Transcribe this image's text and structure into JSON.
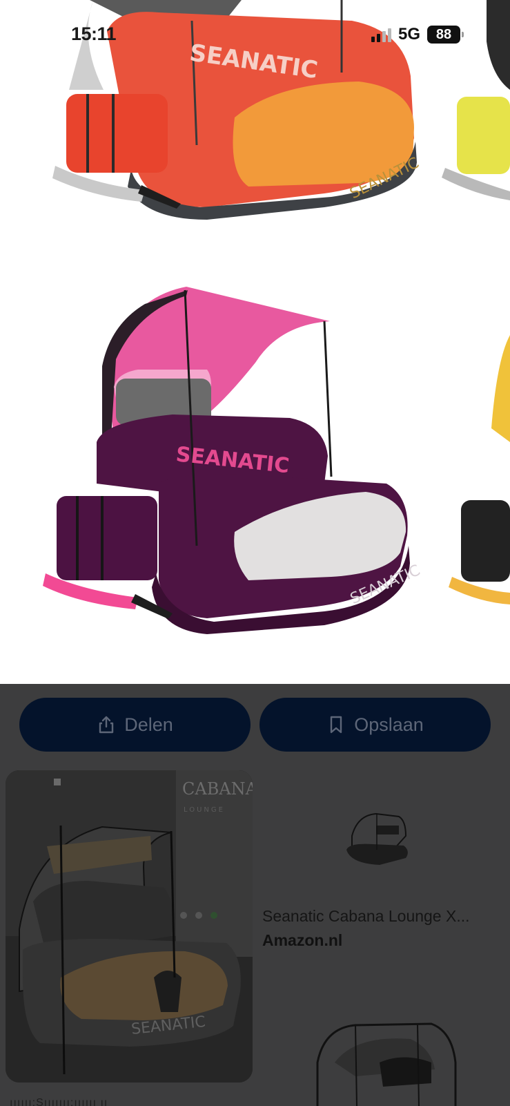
{
  "status_bar": {
    "time": "15:11",
    "network": "5G",
    "battery": "88"
  },
  "hero": {
    "logo_text": "SEANATIC",
    "colors": {
      "top_lounger_red": "#e9533c",
      "top_lounger_orange": "#f29a3a",
      "bottom_canopy_pink": "#e8599f",
      "bottom_cushion_purple": "#4e1443"
    }
  },
  "actions": {
    "share_label": "Delen",
    "save_label": "Opslaan"
  },
  "result": {
    "display_brand": "CABANA",
    "display_sub": "LOUNGE",
    "title": "Seanatic Cabana Lounge X...",
    "source": "Amazon.nl",
    "product_logo": "SEANATIC",
    "cut_text": "ıııııı:Sııııııı:ıııııı ıı"
  },
  "colors": {
    "dim_overlay": "#3d3d3e",
    "button_bg": "#04132b",
    "button_text": "#5d6678"
  }
}
